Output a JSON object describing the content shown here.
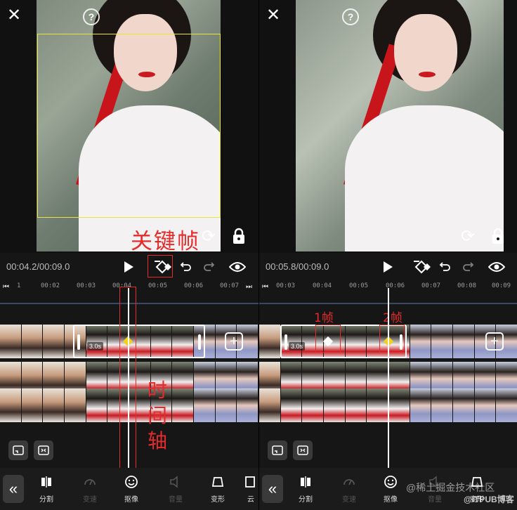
{
  "left": {
    "timecode": "00:04.2/00:09.0",
    "ruler_ticks": [
      "1",
      "00:02",
      "00:03",
      "00:04",
      "00:05",
      "00:06",
      "00:07"
    ],
    "clip_duration": "3.0s",
    "annotations": {
      "keyframe_label": "关键帧",
      "timeline_label": [
        "时",
        "间",
        "轴"
      ]
    }
  },
  "right": {
    "timecode": "00:05.8/00:09.0",
    "ruler_ticks": [
      "00:03",
      "00:04",
      "00:05",
      "00:06",
      "00:07",
      "00:08",
      "00:09"
    ],
    "clip_duration": "3.0s",
    "annotations": {
      "frame1_label": "1帧",
      "frame2_label": "2帧"
    }
  },
  "nav": {
    "split": "分割",
    "speed": "变速",
    "cutout": "抠像",
    "volume": "音量",
    "transform": "变形",
    "more": "云"
  },
  "icons": {
    "close": "close-icon",
    "help": "help-icon",
    "rotate": "rotate-icon",
    "lock": "lock-icon",
    "play": "play-icon",
    "keyframe": "keyframe-icon",
    "undo": "undo-icon",
    "redo": "redo-icon",
    "eye": "eye-icon"
  },
  "watermark": {
    "text": "@稀土掘金技术社区",
    "brand": "@ITPUB博客"
  },
  "colors": {
    "annotation_red": "#e52b2b",
    "selection_yellow": "#e8e53a",
    "keyframe_yellow": "#f0d21c",
    "background": "#161616"
  }
}
